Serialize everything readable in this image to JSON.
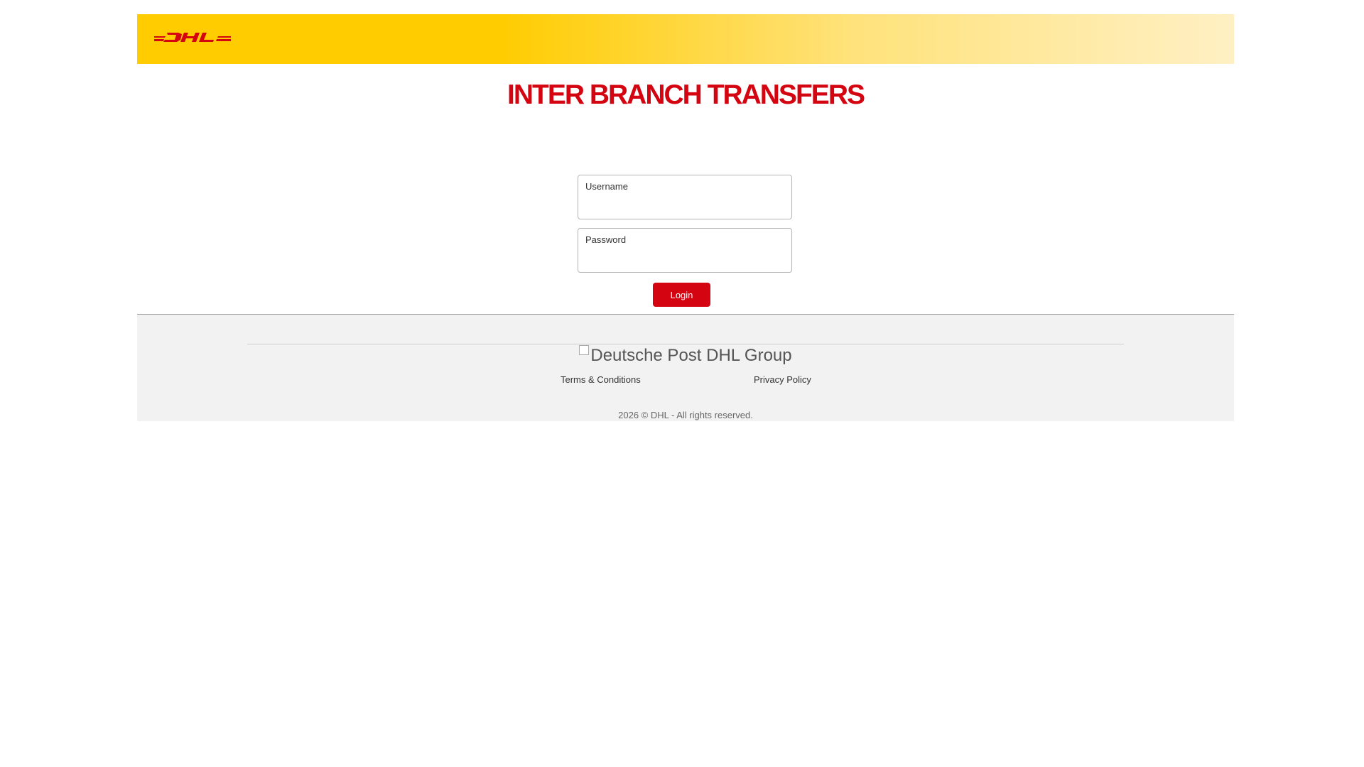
{
  "brand": {
    "logo_icon": "dhl-logo",
    "logo_color": "#d40511",
    "header_color": "#ffcc00"
  },
  "main": {
    "title": "INTER BRANCH TRANSFERS",
    "username_label": "Username",
    "username_value": "",
    "password_label": "Password",
    "password_value": "",
    "login_label": "Login"
  },
  "footer": {
    "group_logo_alt": "Deutsche Post DHL Group",
    "links": [
      {
        "label": "Terms & Conditions"
      },
      {
        "label": "Privacy Policy"
      }
    ],
    "copyright": "2026 © DHL - All rights reserved."
  }
}
